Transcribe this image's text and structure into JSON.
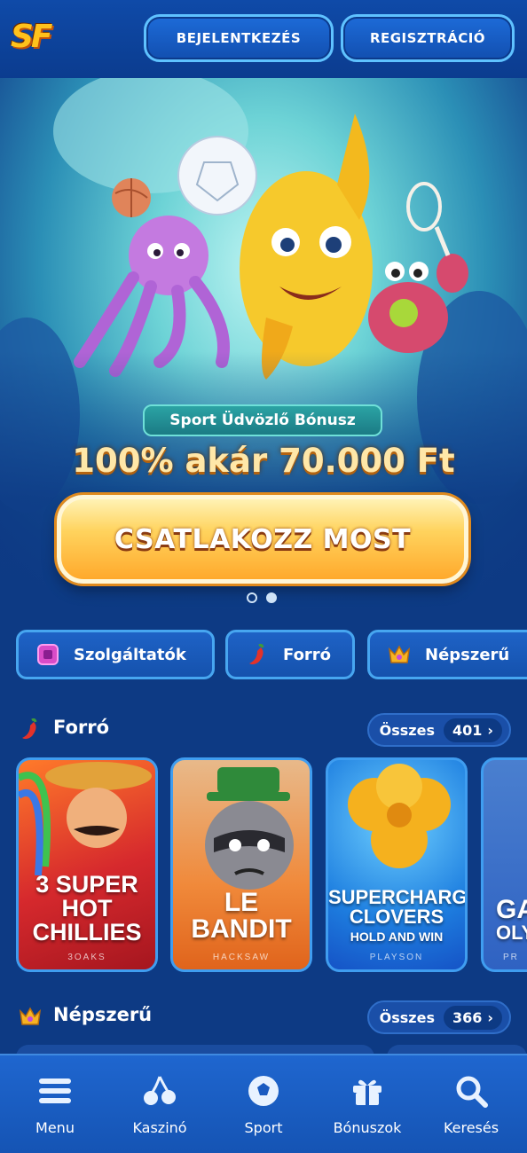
{
  "header": {
    "logo_text": "SF",
    "login_label": "BEJELENTKEZÉS",
    "register_label": "REGISZTRÁCIÓ"
  },
  "hero": {
    "promo_label": "Sport Üdvözlő Bónusz",
    "promo_amount": "100% akár 70.000 Ft",
    "cta_label": "CSATLAKOZZ MOST",
    "slides": 2,
    "active_slide": 2
  },
  "categories": [
    {
      "label": "Szolgáltatók",
      "icon": "providers-icon"
    },
    {
      "label": "Forró",
      "icon": "chili-icon"
    },
    {
      "label": "Népszerű",
      "icon": "crown-icon"
    }
  ],
  "sections": {
    "hot": {
      "title": "Forró",
      "all_label": "Összes",
      "count": "401"
    },
    "popular": {
      "title": "Népszerű",
      "all_label": "Összes",
      "count": "366"
    }
  },
  "games": [
    {
      "title_line1": "3 SUPER HOT",
      "title_line2": "CHILLIES",
      "subtitle": "",
      "provider": "3OAKS",
      "color": "#c8262a"
    },
    {
      "title_line1": "LE BANDIT",
      "title_line2": "",
      "subtitle": "",
      "provider": "HACKSAW",
      "color": "#e8741f"
    },
    {
      "title_line1": "SUPERCHARGED",
      "title_line2": "CLOVERS",
      "subtitle": "HOLD AND WIN",
      "provider": "PLAYSON",
      "color": "#2a8fe6"
    },
    {
      "title_line1": "GA",
      "title_line2": "OLYM",
      "subtitle": "",
      "provider": "PR",
      "color": "#3e7de0"
    }
  ],
  "bottom_nav": [
    {
      "label": "Menu",
      "icon": "hamburger-icon"
    },
    {
      "label": "Kaszinó",
      "icon": "cherries-icon"
    },
    {
      "label": "Sport",
      "icon": "soccer-ball-icon"
    },
    {
      "label": "Bónuszok",
      "icon": "gift-icon"
    },
    {
      "label": "Keresés",
      "icon": "search-icon"
    }
  ],
  "colors": {
    "background": "#0d3a84",
    "accent": "#47a6f0",
    "cta_gold": "#ffa92c"
  }
}
